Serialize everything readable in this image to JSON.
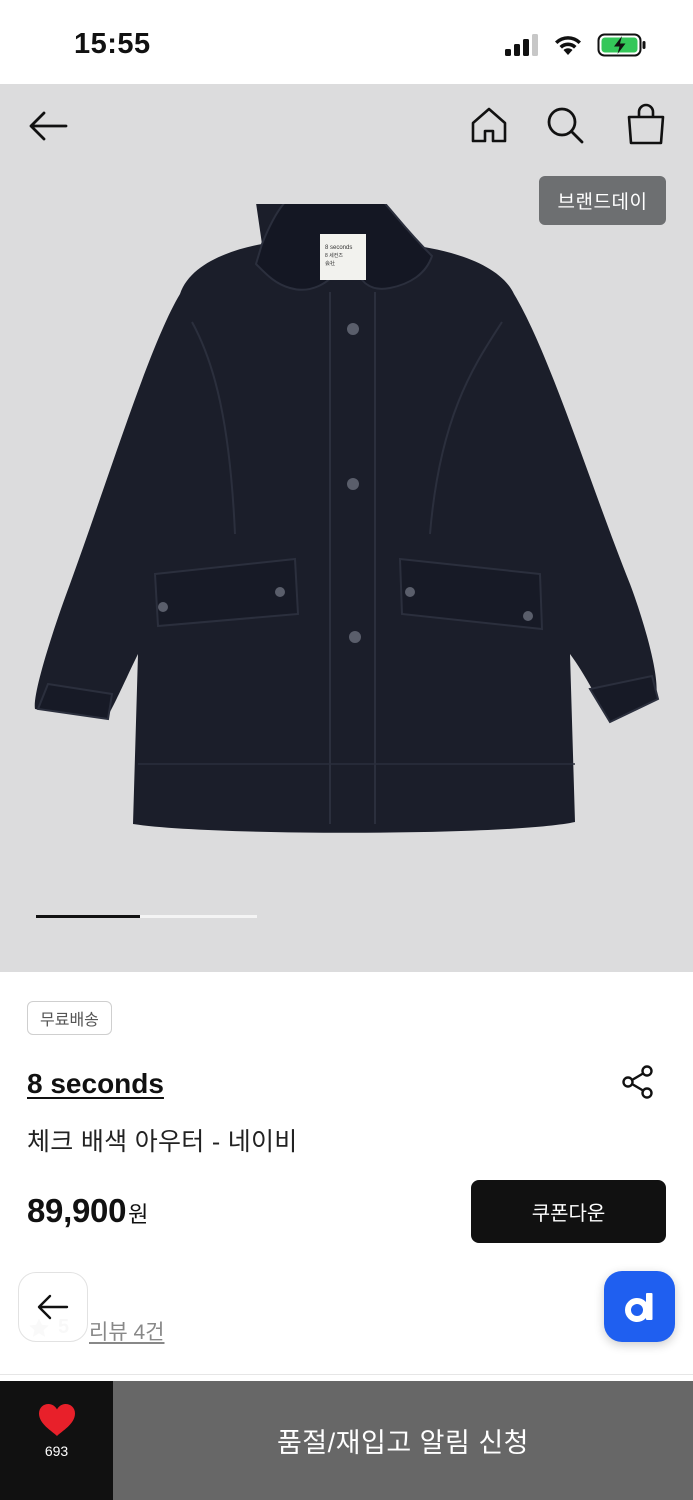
{
  "status_bar": {
    "time": "15:55"
  },
  "hero": {
    "brand_day_label": "브랜드데이",
    "carousel_progress": 0.47
  },
  "product": {
    "badge": "무료배송",
    "brand": "8 seconds",
    "title": "체크 배색 아우터 - 네이비",
    "price": "89,900",
    "price_unit": "원",
    "coupon_label": "쿠폰다운",
    "rating": "5",
    "review_text": "리뷰 4건"
  },
  "bottom_bar": {
    "like_count": "693",
    "restock_label": "품절/재입고 알림 신청"
  },
  "colors": {
    "accent_blue": "#1f5ff0",
    "like_red": "#e8202a",
    "battery_green": "#34c759",
    "hero_bg": "#dcdcdd"
  },
  "icons": [
    "back-arrow-icon",
    "home-icon",
    "search-icon",
    "shopping-bag-icon",
    "share-icon",
    "star-icon",
    "heart-icon",
    "d-logo-icon",
    "signal-icon",
    "wifi-icon",
    "battery-icon"
  ]
}
